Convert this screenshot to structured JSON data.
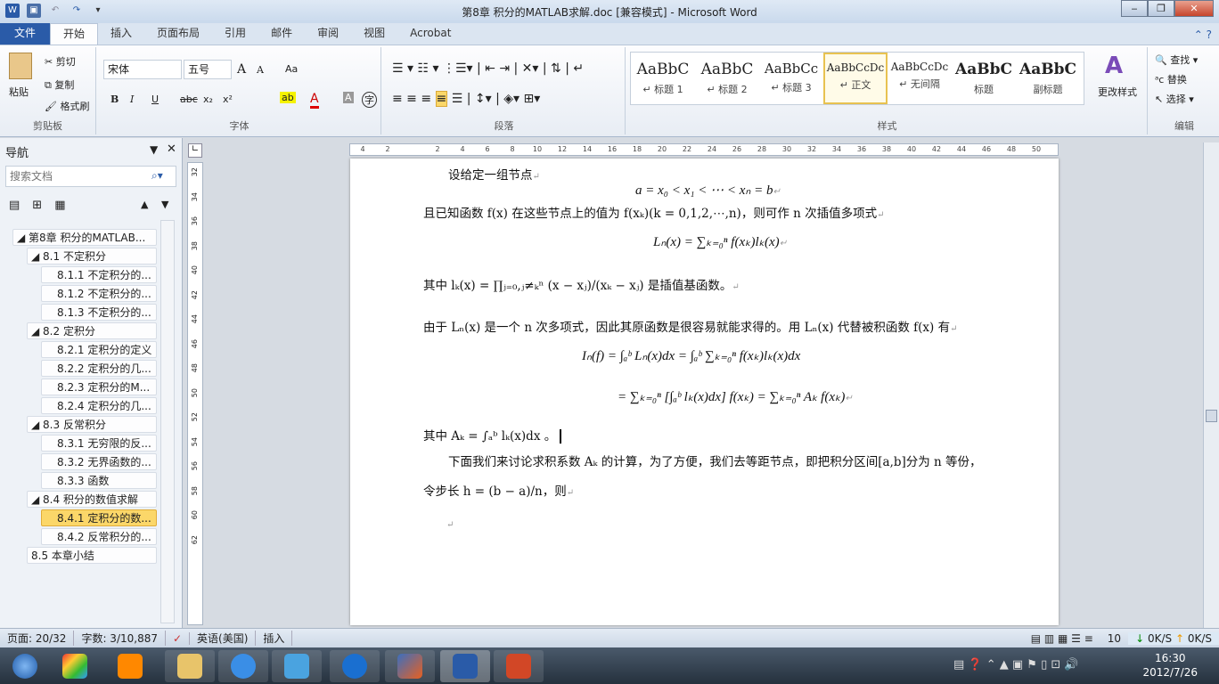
{
  "window": {
    "title": "第8章  积分的MATLAB求解.doc [兼容模式] - Microsoft Word",
    "minimize": "‒",
    "restore": "❐",
    "close": "✕"
  },
  "tabs": [
    "文件",
    "开始",
    "插入",
    "页面布局",
    "引用",
    "邮件",
    "审阅",
    "视图",
    "Acrobat"
  ],
  "ribbon": {
    "clipboard": {
      "paste": "粘贴",
      "cut": "剪切",
      "copy": "复制",
      "format_painter": "格式刷",
      "label": "剪贴板"
    },
    "font": {
      "name": "宋体",
      "size": "五号",
      "label": "字体",
      "grow": "A",
      "shrink": "A",
      "case": "Aa",
      "bold": "B",
      "italic": "I",
      "underline": "U",
      "strike": "abc",
      "sub": "x₂",
      "sup": "x²",
      "color": "A",
      "shade": "A",
      "enclose": "字"
    },
    "paragraph": {
      "label": "段落"
    },
    "styles": {
      "label": "样式",
      "items": [
        {
          "preview": "AaBbC",
          "name": "↵ 标题 1"
        },
        {
          "preview": "AaBbC",
          "name": "↵ 标题 2"
        },
        {
          "preview": "AaBbCc",
          "name": "↵ 标题 3"
        },
        {
          "preview": "AaBbCcDc",
          "name": "↵ 正文"
        },
        {
          "preview": "AaBbCcDc",
          "name": "↵ 无间隔"
        },
        {
          "preview": "AaBbC",
          "name": "标题"
        },
        {
          "preview": "AaBbC",
          "name": "副标题"
        }
      ],
      "change": "更改样式"
    },
    "editing": {
      "label": "编辑",
      "find": "查找",
      "replace": "替换",
      "select": "选择"
    }
  },
  "nav": {
    "title": "导航",
    "search_placeholder": "搜索文档",
    "items": [
      {
        "label": "◢ 第8章  积分的MATLAB...",
        "level": 0
      },
      {
        "label": "◢ 8.1  不定积分",
        "level": 1
      },
      {
        "label": "8.1.1  不定积分的...",
        "level": 2
      },
      {
        "label": "8.1.2  不定积分的...",
        "level": 2
      },
      {
        "label": "8.1.3  不定积分的...",
        "level": 2
      },
      {
        "label": "◢ 8.2  定积分",
        "level": 1
      },
      {
        "label": "8.2.1  定积分的定义",
        "level": 2
      },
      {
        "label": "8.2.2  定积分的几...",
        "level": 2
      },
      {
        "label": "8.2.3  定积分的M...",
        "level": 2
      },
      {
        "label": "8.2.4  定积分的几...",
        "level": 2
      },
      {
        "label": "◢ 8.3  反常积分",
        "level": 1
      },
      {
        "label": "8.3.1  无穷限的反...",
        "level": 2
      },
      {
        "label": "8.3.2  无界函数的...",
        "level": 2
      },
      {
        "label": "8.3.3  函数",
        "level": 2
      },
      {
        "label": "◢ 8.4  积分的数值求解",
        "level": 1
      },
      {
        "label": "8.4.1  定积分的数...",
        "level": 2,
        "selected": true
      },
      {
        "label": "8.4.2  反常积分的...",
        "level": 2
      },
      {
        "label": "8.5  本章小结",
        "level": 1
      }
    ]
  },
  "ruler": {
    "h": [
      "4",
      "2",
      "",
      "2",
      "4",
      "6",
      "8",
      "10",
      "12",
      "14",
      "16",
      "18",
      "20",
      "22",
      "24",
      "26",
      "28",
      "30",
      "32",
      "34",
      "36",
      "38",
      "40",
      "42",
      "44",
      "46",
      "48",
      "50"
    ],
    "v": [
      "32",
      "34",
      "36",
      "38",
      "40",
      "42",
      "44",
      "46",
      "48",
      "50",
      "52",
      "54",
      "56",
      "58",
      "60",
      "62"
    ]
  },
  "document": {
    "lines": [
      "设给定一组节点",
      "a = x₀ < x₁ < ⋯ < xₙ = b",
      "且已知函数 f(x) 在这些节点上的值为 f(xₖ)(k = 0,1,2,⋯,n)，则可作 n 次插值多项式",
      "Lₙ(x) = ∑ₖ₌₀ⁿ f(xₖ)lₖ(x)",
      "其中 lₖ(x) = ∏ⱼ₌₀,ⱼ≠ₖⁿ (x − xⱼ)/(xₖ − xⱼ) 是插值基函数。",
      "由于 Lₙ(x) 是一个 n 次多项式，因此其原函数是很容易就能求得的。用 Lₙ(x) 代替被积函数 f(x) 有",
      "Iₙ(f) = ∫ₐᵇ Lₙ(x)dx = ∫ₐᵇ ∑ₖ₌₀ⁿ f(xₖ)lₖ(x)dx",
      "= ∑ₖ₌₀ⁿ [∫ₐᵇ lₖ(x)dx] f(xₖ) = ∑ₖ₌₀ⁿ Aₖ f(xₖ)",
      "其中 Aₖ = ∫ₐᵇ lₖ(x)dx 。",
      "下面我们来讨论求积系数 Aₖ 的计算，为了方便，我们去等距节点，即把积分区间[a,b]分为 n 等份，",
      "令步长 h = (b − a)/n，则"
    ]
  },
  "status": {
    "page": "页面: 20/32",
    "words": "字数: 3/10,887",
    "language": "英语(美国)",
    "mode": "插入",
    "zoom": "10",
    "down_speed": "0K/S",
    "up_speed": "0K/S"
  },
  "taskbar": {
    "time": "16:30",
    "date": "2012/7/26"
  },
  "colors": {
    "file_tab": "#2a5ba8",
    "selected_nav": "#fbd769",
    "accent": "#e8c250"
  }
}
